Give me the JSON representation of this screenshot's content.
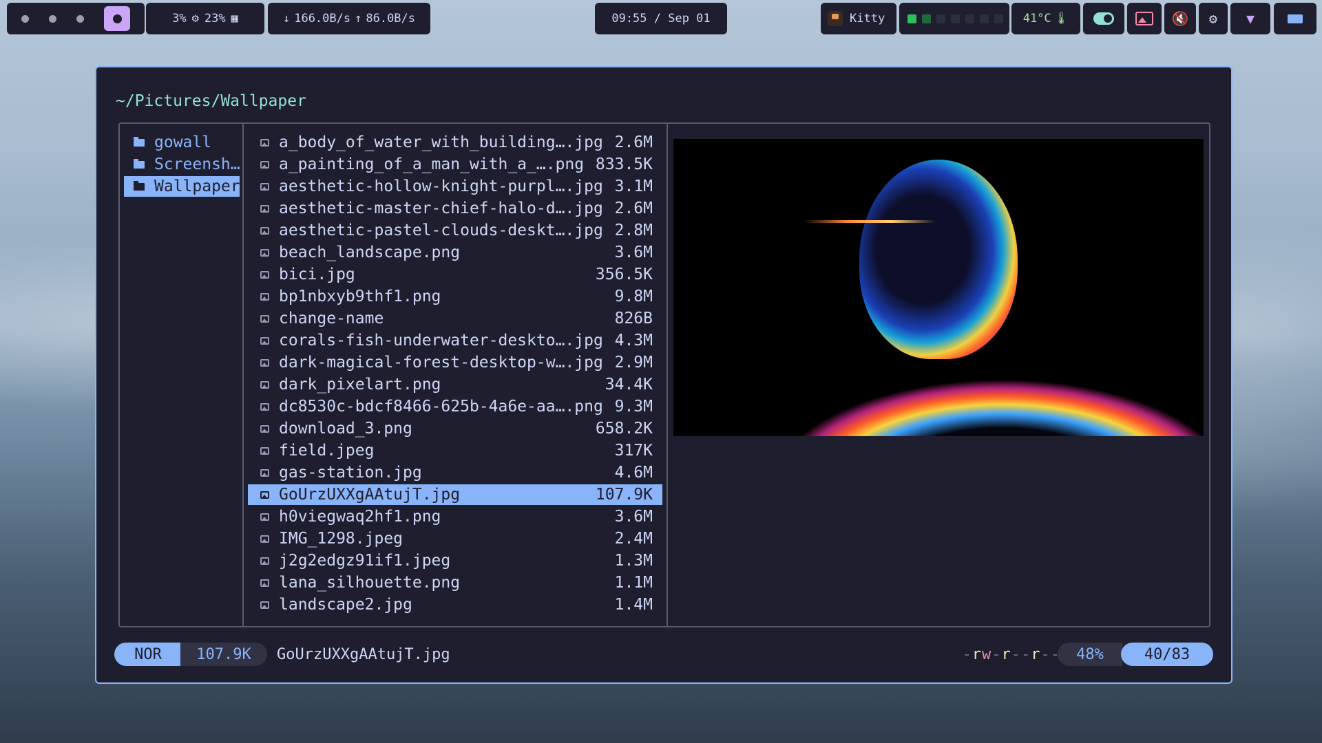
{
  "topbar": {
    "cpu": "3%",
    "mem": "23%",
    "down": "166.0B/s",
    "up": "86.0B/s",
    "clock": "09:55 / Sep 01",
    "app": "Kitty",
    "temp": "41°C",
    "icons": [
      "chip-icon",
      "memory-icon",
      "arrow-down-icon",
      "arrow-up-icon",
      "kitty-icon",
      "thermometer-icon",
      "toggle-icon",
      "image-icon",
      "mute-icon",
      "gear-icon",
      "wifi-icon",
      "battery-icon"
    ]
  },
  "window": {
    "path": "~/Pictures/Wallpaper",
    "dirs": [
      {
        "label": "gowall",
        "selected": false
      },
      {
        "label": "Screensh…",
        "selected": false
      },
      {
        "label": "Wallpaper",
        "selected": true
      }
    ],
    "files": [
      {
        "name": "a_body_of_water_with_building….jpg",
        "size": "2.6M"
      },
      {
        "name": "a_painting_of_a_man_with_a_….png",
        "size": "833.5K"
      },
      {
        "name": "aesthetic-hollow-knight-purpl….jpg",
        "size": "3.1M"
      },
      {
        "name": "aesthetic-master-chief-halo-d….jpg",
        "size": "2.6M"
      },
      {
        "name": "aesthetic-pastel-clouds-deskt….jpg",
        "size": "2.8M"
      },
      {
        "name": "beach_landscape.png",
        "size": "3.6M"
      },
      {
        "name": "bici.jpg",
        "size": "356.5K"
      },
      {
        "name": "bp1nbxyb9thf1.png",
        "size": "9.8M"
      },
      {
        "name": "change-name",
        "size": "826B"
      },
      {
        "name": "corals-fish-underwater-deskto….jpg",
        "size": "4.3M"
      },
      {
        "name": "dark-magical-forest-desktop-w….jpg",
        "size": "2.9M"
      },
      {
        "name": "dark_pixelart.png",
        "size": "34.4K"
      },
      {
        "name": "dc8530c-bdcf8466-625b-4a6e-aa….png",
        "size": "9.3M"
      },
      {
        "name": "download_3.png",
        "size": "658.2K"
      },
      {
        "name": "field.jpeg",
        "size": "317K"
      },
      {
        "name": "gas-station.jpg",
        "size": "4.6M"
      },
      {
        "name": "GoUrzUXXgAAtujT.jpg",
        "size": "107.9K",
        "selected": true
      },
      {
        "name": "h0viegwaq2hf1.png",
        "size": "3.6M"
      },
      {
        "name": "IMG_1298.jpeg",
        "size": "2.4M"
      },
      {
        "name": "j2g2edgz91if1.jpeg",
        "size": "1.3M"
      },
      {
        "name": "lana_silhouette.png",
        "size": "1.1M"
      },
      {
        "name": "landscape2.jpg",
        "size": "1.4M"
      }
    ],
    "status": {
      "mode": "NOR",
      "size": "107.9K",
      "filename": "GoUrzUXXgAAtujT.jpg",
      "permissions": "-rw-r--r--",
      "percent": "48%",
      "position": "40/83"
    }
  }
}
